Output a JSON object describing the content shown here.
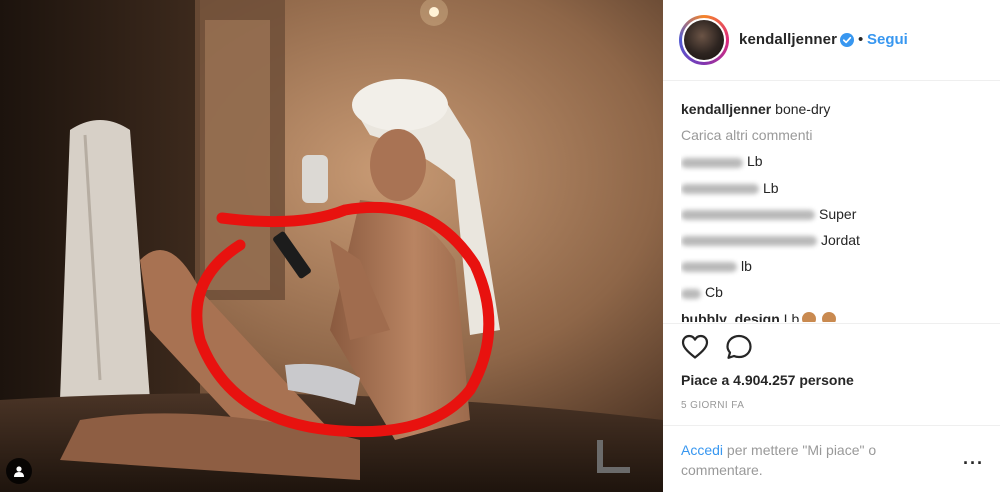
{
  "post": {
    "username": "kendalljenner",
    "follow_label": "Segui",
    "dot_separator": "•",
    "caption_user": "kendalljenner",
    "caption_text": "bone-dry",
    "load_more_label": "Carica altri commenti",
    "comments": [
      {
        "text": "Lb"
      },
      {
        "text": "Lb"
      },
      {
        "text": "Super"
      },
      {
        "text": "Jordat"
      },
      {
        "text": "lb"
      },
      {
        "text": "Cb"
      },
      {
        "user": "bubbly_design",
        "text": "Lb"
      }
    ],
    "likes_text": "Piace a 4.904.257 persone",
    "time_ago": "5 GIORNI FA",
    "login_link": "Accedi",
    "login_text": "per mettere \"Mi piace\" o commentare.",
    "more_label": "···"
  },
  "colors": {
    "link": "#3897f0",
    "muted": "#999999",
    "text": "#262626",
    "annotation": "#e8120f"
  },
  "icons": {
    "verified": "verified-badge-icon",
    "like": "heart-outline-icon",
    "comment": "comment-bubble-icon",
    "tag": "user-tag-icon"
  }
}
